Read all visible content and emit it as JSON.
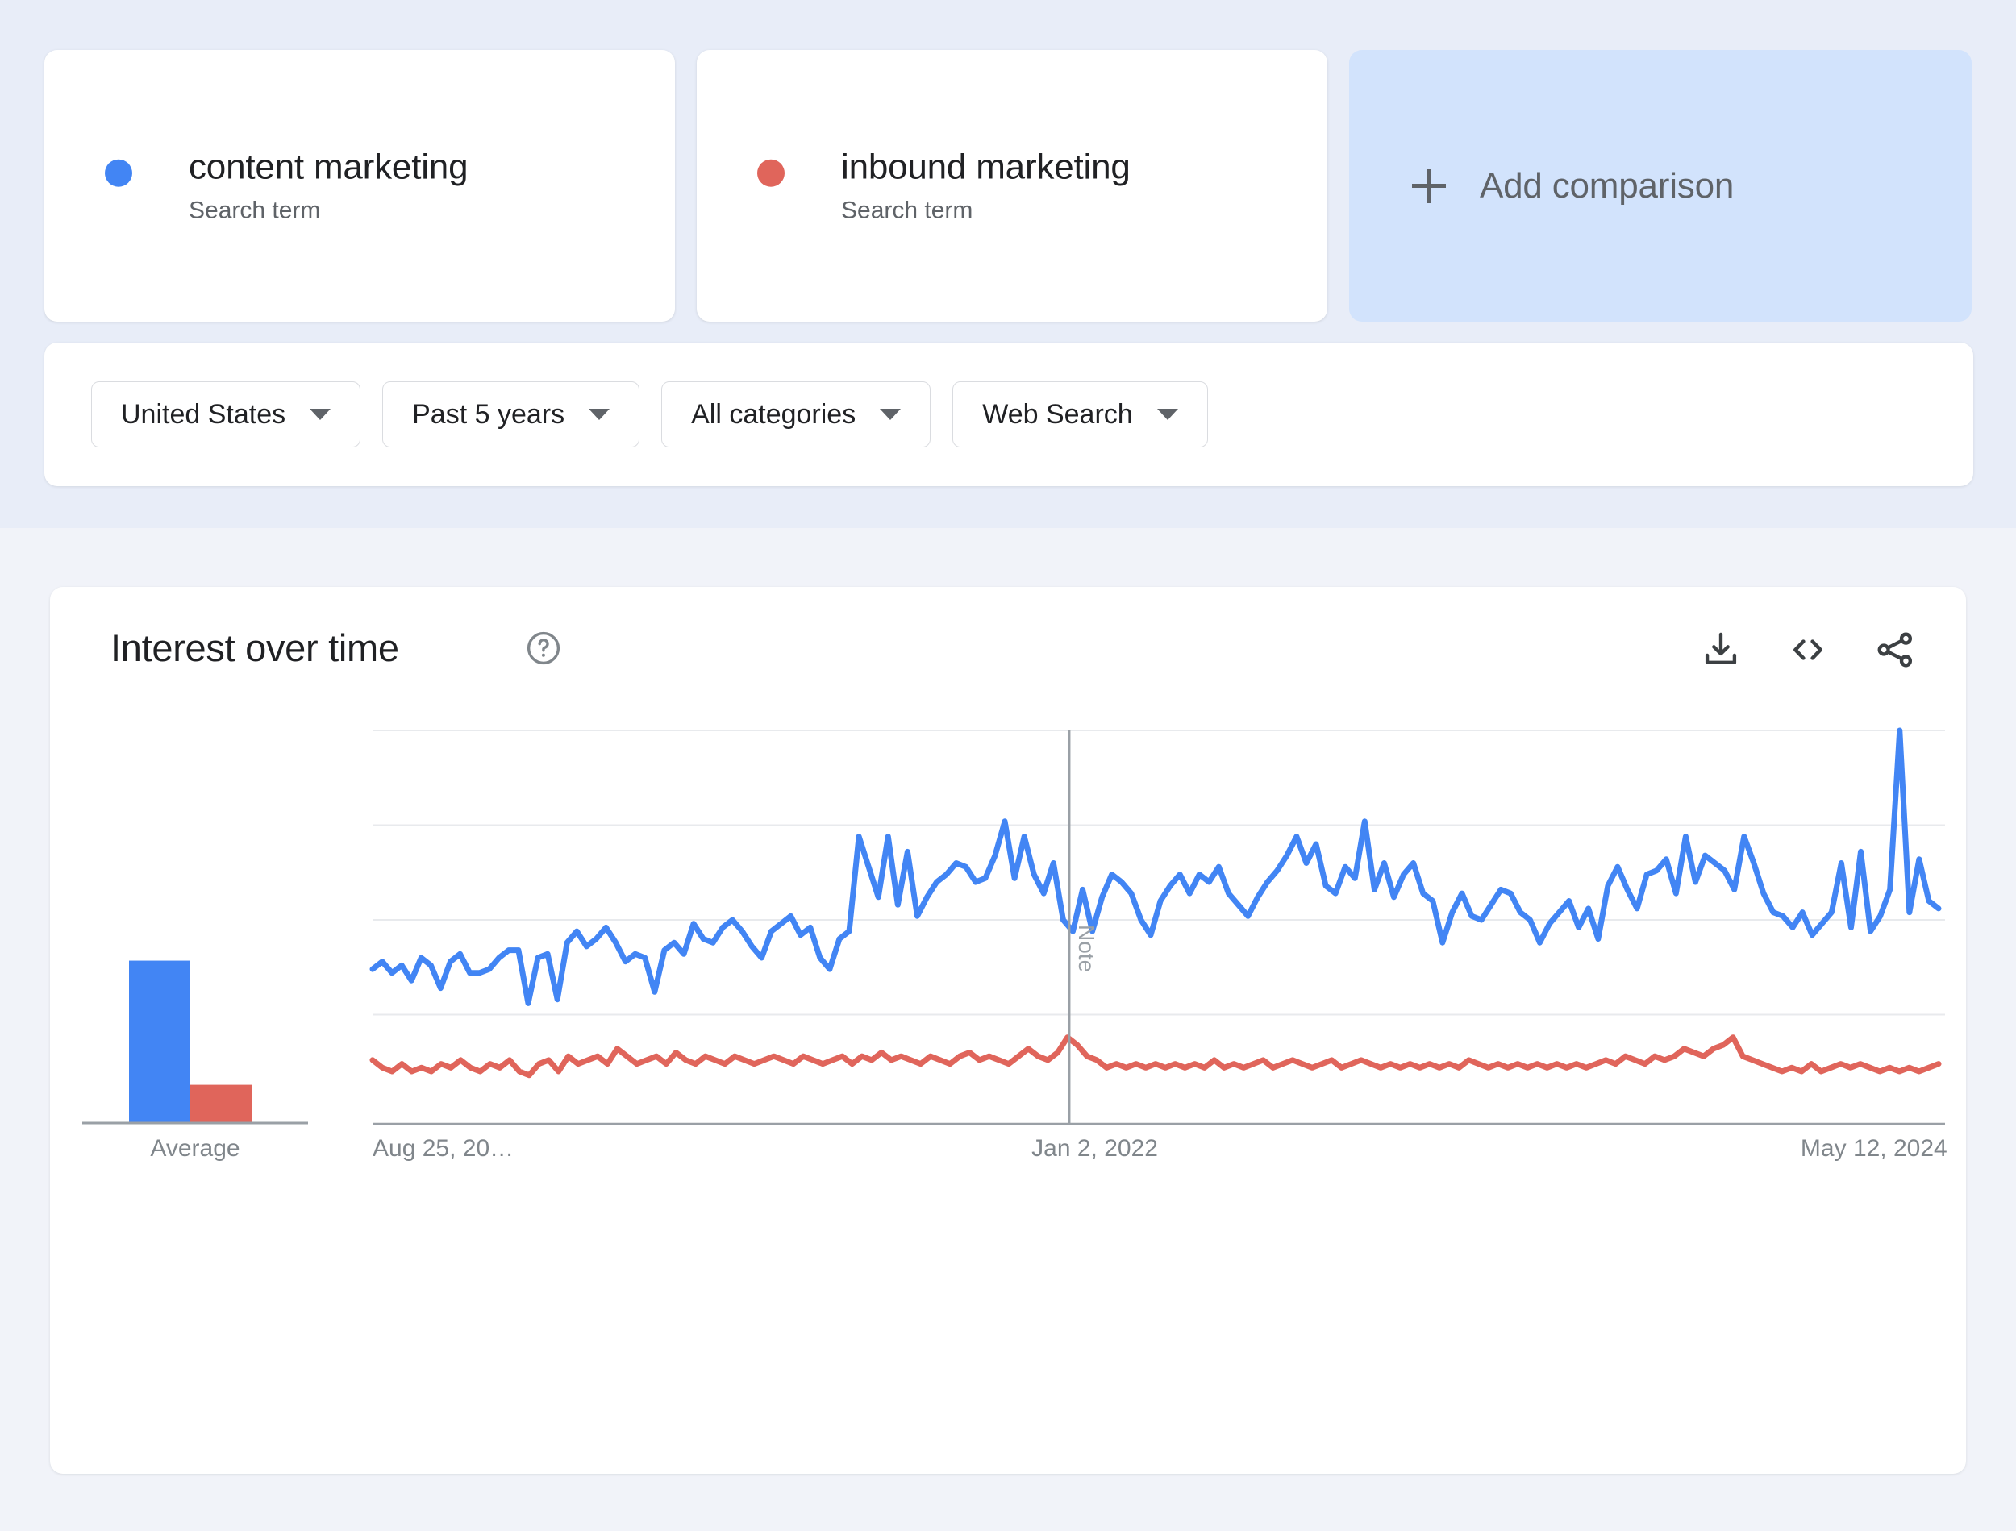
{
  "colors": {
    "series1": "#4285F4",
    "series2": "#E0655B",
    "page_bg_top": "#E8EDF8",
    "page_bg_bottom": "#F1F3F9",
    "add_comparison_bg": "#D2E3FC",
    "card_bg": "#FFFFFF",
    "text_primary": "#202124",
    "text_secondary": "#5F6368",
    "axis_text": "#80868B"
  },
  "terms": [
    {
      "name": "content marketing",
      "type": "Search term",
      "color": "#4285F4"
    },
    {
      "name": "inbound marketing",
      "type": "Search term",
      "color": "#E0655B"
    }
  ],
  "add_comparison": {
    "label": "Add comparison",
    "icon": "plus-icon"
  },
  "filters": [
    {
      "name": "location",
      "label": "United States"
    },
    {
      "name": "time-range",
      "label": "Past 5 years"
    },
    {
      "name": "category",
      "label": "All categories"
    },
    {
      "name": "search-type",
      "label": "Web Search"
    }
  ],
  "chart_card": {
    "title": "Interest over time",
    "help_icon": "help-circle-icon",
    "actions": [
      {
        "name": "download",
        "icon": "download-icon"
      },
      {
        "name": "embed",
        "icon": "code-icon"
      },
      {
        "name": "share",
        "icon": "share-icon"
      }
    ]
  },
  "chart_data": {
    "type": "line",
    "title": "Interest over time",
    "xlabel": "",
    "ylabel": "",
    "ylim": [
      0,
      100
    ],
    "yticks": [
      25,
      50,
      75,
      100
    ],
    "grid": true,
    "legend_position": "top-cards",
    "x_tick_labels": [
      "Aug 25, 20…",
      "Jan 2, 2022",
      "May 12, 2024"
    ],
    "x_tick_positions_pct": [
      0,
      44.5,
      94
    ],
    "annotations": [
      {
        "label": "Note",
        "x_pct": 44.5,
        "orientation": "vertical"
      }
    ],
    "series": [
      {
        "name": "content marketing",
        "color": "#4285F4",
        "values": [
          37,
          39,
          36,
          38,
          34,
          40,
          38,
          32,
          39,
          41,
          36,
          36,
          37,
          40,
          42,
          42,
          28,
          40,
          41,
          29,
          44,
          47,
          43,
          45,
          48,
          44,
          39,
          41,
          40,
          31,
          42,
          44,
          41,
          49,
          45,
          44,
          48,
          50,
          47,
          43,
          40,
          47,
          49,
          51,
          46,
          48,
          40,
          37,
          45,
          47,
          72,
          64,
          56,
          72,
          54,
          68,
          51,
          56,
          60,
          62,
          65,
          64,
          60,
          61,
          67,
          76,
          61,
          72,
          62,
          57,
          65,
          50,
          47,
          58,
          47,
          56,
          62,
          60,
          57,
          50,
          46,
          55,
          59,
          62,
          57,
          62,
          60,
          64,
          57,
          54,
          51,
          56,
          60,
          63,
          67,
          72,
          65,
          70,
          59,
          57,
          64,
          61,
          76,
          58,
          65,
          56,
          62,
          65,
          57,
          55,
          44,
          52,
          57,
          51,
          50,
          54,
          58,
          57,
          52,
          50,
          44,
          49,
          52,
          55,
          48,
          53,
          45,
          59,
          64,
          58,
          53,
          62,
          63,
          66,
          57,
          72,
          60,
          67,
          65,
          63,
          58,
          72,
          65,
          57,
          52,
          51,
          48,
          52,
          46,
          49,
          52,
          65,
          48,
          68,
          47,
          51,
          58,
          100,
          52,
          66,
          55,
          53
        ]
      },
      {
        "name": "inbound marketing",
        "color": "#E0655B",
        "values": [
          13,
          11,
          10,
          12,
          10,
          11,
          10,
          12,
          11,
          13,
          11,
          10,
          12,
          11,
          13,
          10,
          9,
          12,
          13,
          10,
          14,
          12,
          13,
          14,
          12,
          16,
          14,
          12,
          13,
          14,
          12,
          15,
          13,
          12,
          14,
          13,
          12,
          14,
          13,
          12,
          13,
          14,
          13,
          12,
          14,
          13,
          12,
          13,
          14,
          12,
          14,
          13,
          15,
          13,
          14,
          13,
          12,
          14,
          13,
          12,
          14,
          15,
          13,
          14,
          13,
          12,
          14,
          16,
          14,
          13,
          15,
          19,
          17,
          14,
          13,
          11,
          12,
          11,
          12,
          11,
          12,
          11,
          12,
          11,
          12,
          11,
          13,
          11,
          12,
          11,
          12,
          13,
          11,
          12,
          13,
          12,
          11,
          12,
          13,
          11,
          12,
          13,
          12,
          11,
          12,
          11,
          12,
          11,
          12,
          11,
          12,
          11,
          13,
          12,
          11,
          12,
          11,
          12,
          11,
          12,
          11,
          12,
          11,
          12,
          11,
          12,
          13,
          12,
          14,
          13,
          12,
          14,
          13,
          14,
          16,
          15,
          14,
          16,
          17,
          19,
          14,
          13,
          12,
          11,
          10,
          11,
          10,
          12,
          10,
          11,
          12,
          11,
          12,
          11,
          10,
          11,
          10,
          11,
          10,
          11,
          12
        ]
      }
    ]
  },
  "average_chart": {
    "type": "bar",
    "label": "Average",
    "categories": [
      "content marketing",
      "inbound marketing"
    ],
    "values": [
      51,
      12
    ],
    "colors": [
      "#4285F4",
      "#E0655B"
    ],
    "ylim": [
      0,
      100
    ]
  }
}
